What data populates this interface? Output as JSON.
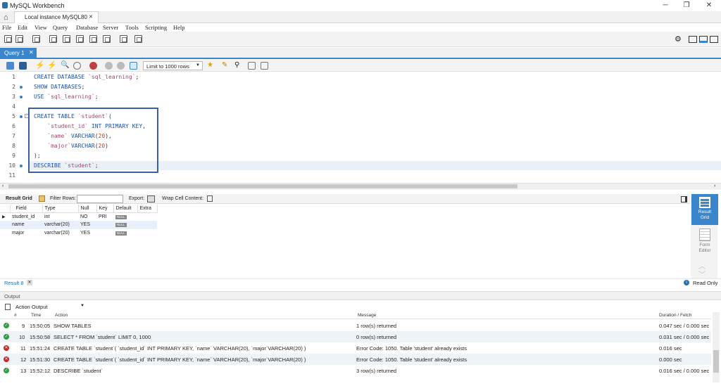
{
  "window": {
    "title": "MySQL Workbench"
  },
  "connection_tab": {
    "label": "Local instance MySQL80"
  },
  "menu": [
    "File",
    "Edit",
    "View",
    "Query",
    "Database",
    "Server",
    "Tools",
    "Scripting",
    "Help"
  ],
  "query_tab": {
    "label": "Query 1"
  },
  "limit_select": {
    "value": "Limit to 1000 rows"
  },
  "editor": {
    "line_numbers": [
      "1",
      "2",
      "3",
      "4",
      "5",
      "6",
      "7",
      "8",
      "9",
      "10",
      "11"
    ]
  },
  "results": {
    "toolbar": {
      "result_grid": "Result Grid",
      "filter_rows": "Filter Rows:",
      "export": "Export:",
      "wrap": "Wrap Cell Content:"
    },
    "columns": [
      "Field",
      "Type",
      "Null",
      "Key",
      "Default",
      "Extra"
    ],
    "rows": [
      {
        "field": "student_id",
        "type": "int",
        "null": "NO",
        "key": "PRI",
        "default": "NULL",
        "extra": ""
      },
      {
        "field": "name",
        "type": "varchar(20)",
        "null": "YES",
        "key": "",
        "default": "NULL",
        "extra": ""
      },
      {
        "field": "major",
        "type": "varchar(20)",
        "null": "YES",
        "key": "",
        "default": "NULL",
        "extra": ""
      }
    ],
    "side": {
      "result_grid": "Result Grid",
      "form_editor": "Form Editor"
    },
    "tab_label": "Result 8",
    "read_only": "Read Only"
  },
  "output": {
    "title": "Output",
    "selector": "Action Output",
    "columns": {
      "num": "#",
      "time": "Time",
      "action": "Action",
      "message": "Message",
      "duration": "Duration / Fetch"
    },
    "rows": [
      {
        "status": "ok",
        "num": "9",
        "time": "15:50:05",
        "action": "SHOW TABLES",
        "message": "1 row(s) returned",
        "duration": "0.047 sec / 0.000 sec"
      },
      {
        "status": "ok",
        "num": "10",
        "time": "15:50:58",
        "action": "SELECT * FROM `student` LIMIT 0, 1000",
        "message": "0 row(s) returned",
        "duration": "0.031 sec / 0.000 sec"
      },
      {
        "status": "error",
        "num": "11",
        "time": "15:51:24",
        "action": "CREATE TABLE `student`( `student_id` INT PRIMARY KEY,     `name` VARCHAR(20),     `major`VARCHAR(20) )",
        "message": "Error Code: 1050. Table 'student' already exists",
        "duration": "0.016 sec"
      },
      {
        "status": "error",
        "num": "12",
        "time": "15:51:30",
        "action": "CREATE TABLE `student`( `student_id` INT PRIMARY KEY,     `name` VARCHAR(20),     `major`VARCHAR(20) )",
        "message": "Error Code: 1050. Table 'student' already exists",
        "duration": "0.000 sec"
      },
      {
        "status": "ok",
        "num": "13",
        "time": "15:52:12",
        "action": "DESCRIBE `student`",
        "message": "3 row(s) returned",
        "duration": "0.016 sec / 0.000 sec"
      }
    ]
  },
  "colors": {
    "accent": "#3a86cc",
    "ok": "#2e9e3e",
    "error": "#c62828",
    "keyword": "#1a52a8",
    "string": "#b04070"
  }
}
